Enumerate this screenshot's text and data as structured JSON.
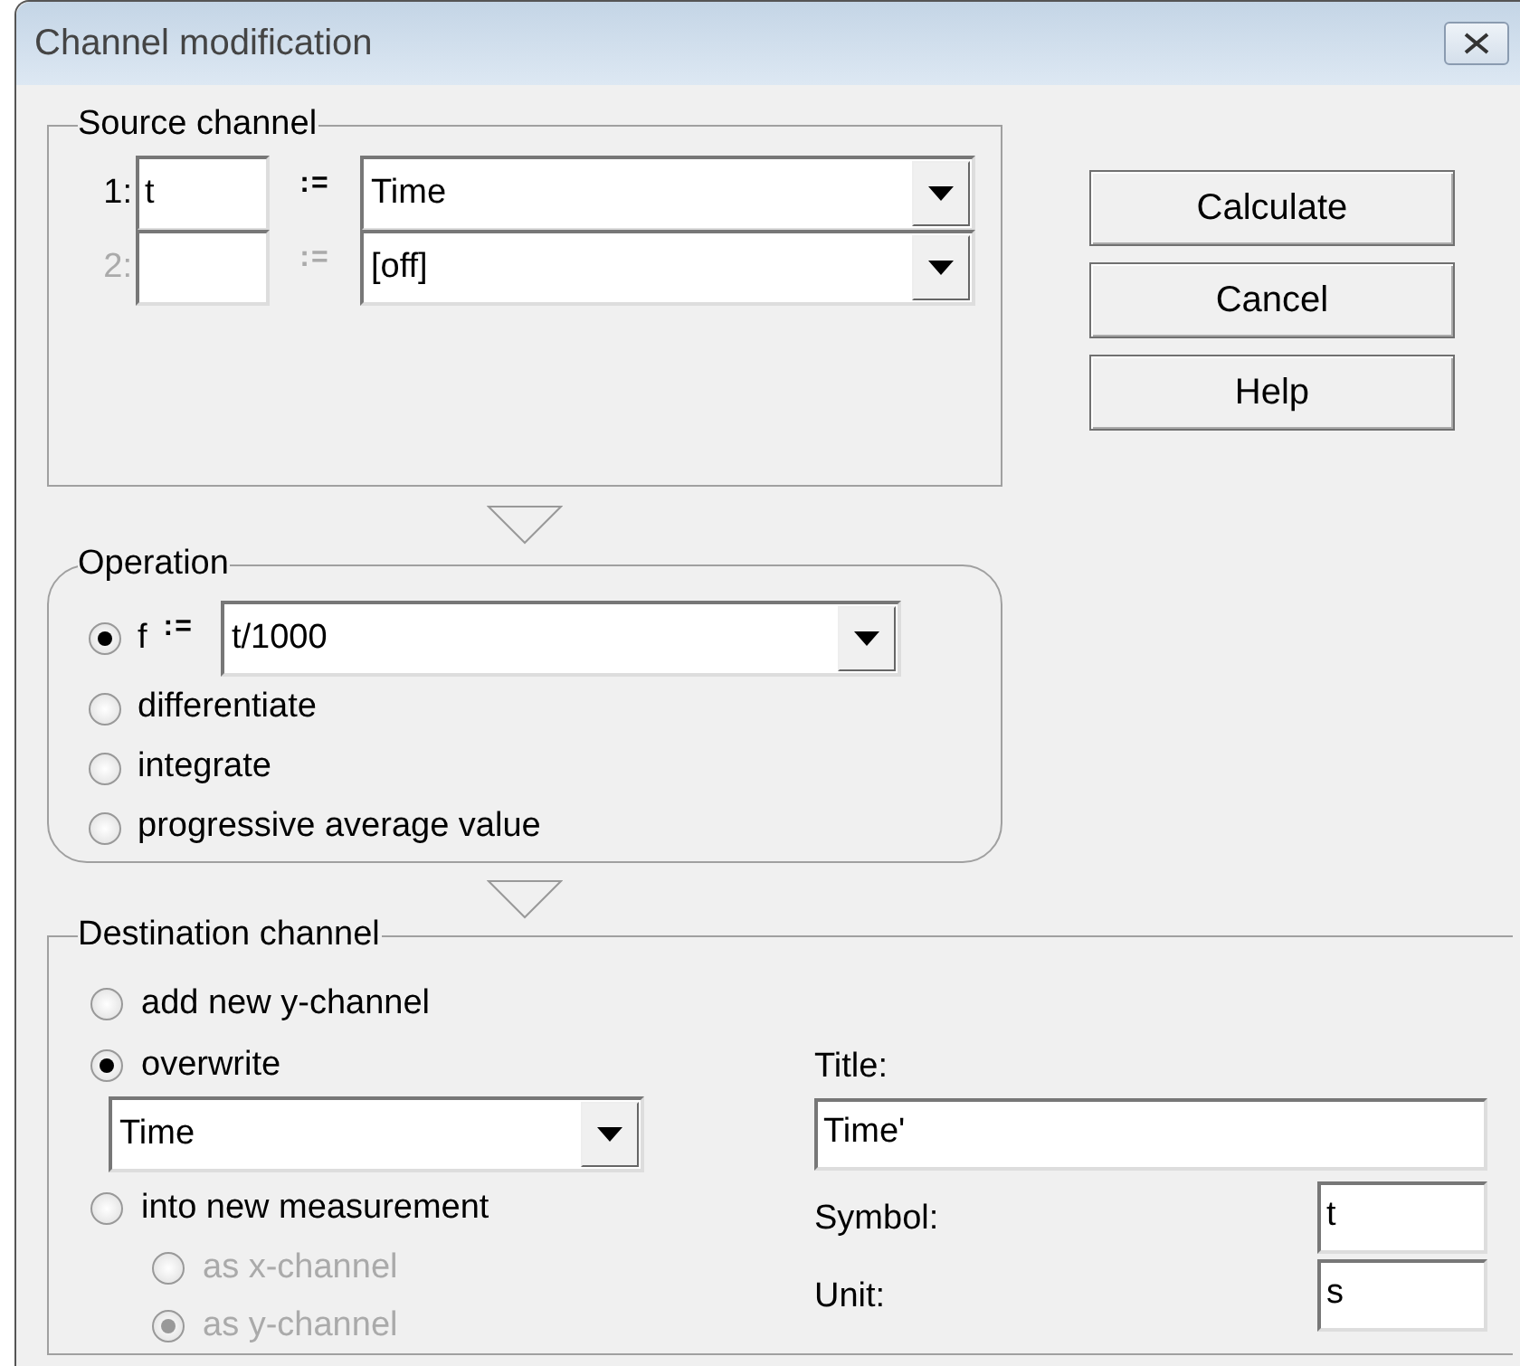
{
  "window": {
    "title": "Channel modification"
  },
  "source": {
    "label": "Source channel",
    "rows": [
      {
        "index": "1:",
        "symbol": "t",
        "assign": ":=",
        "channel": "Time",
        "disabled": false
      },
      {
        "index": "2:",
        "assign": ":=",
        "channel": "[off]",
        "disabled": true
      }
    ]
  },
  "buttons": [
    "Calculate",
    "Cancel",
    "Help"
  ],
  "operation": {
    "label": "Operation",
    "options": [
      {
        "kind": "formula",
        "label": "f",
        "assign": ":=",
        "value": "t/1000",
        "selected": true
      },
      {
        "kind": "plain",
        "label": "differentiate",
        "selected": false
      },
      {
        "kind": "plain",
        "label": "integrate",
        "selected": false
      },
      {
        "kind": "plain",
        "label": "progressive average value",
        "selected": false
      }
    ]
  },
  "destination": {
    "label": "Destination channel",
    "options": [
      {
        "label": "add new y-channel",
        "selected": false
      },
      {
        "label": "overwrite",
        "selected": true,
        "channel": "Time"
      },
      {
        "label": "into new measurement",
        "selected": false,
        "suboptions": [
          {
            "label": "as x-channel",
            "selected": false,
            "disabled": true
          },
          {
            "label": "as y-channel",
            "selected": true,
            "disabled": true
          }
        ]
      }
    ],
    "title_label": "Title:",
    "title_value": "Time'",
    "symbol_label": "Symbol:",
    "symbol_value": "t",
    "unit_label": "Unit:",
    "unit_value": "s"
  }
}
